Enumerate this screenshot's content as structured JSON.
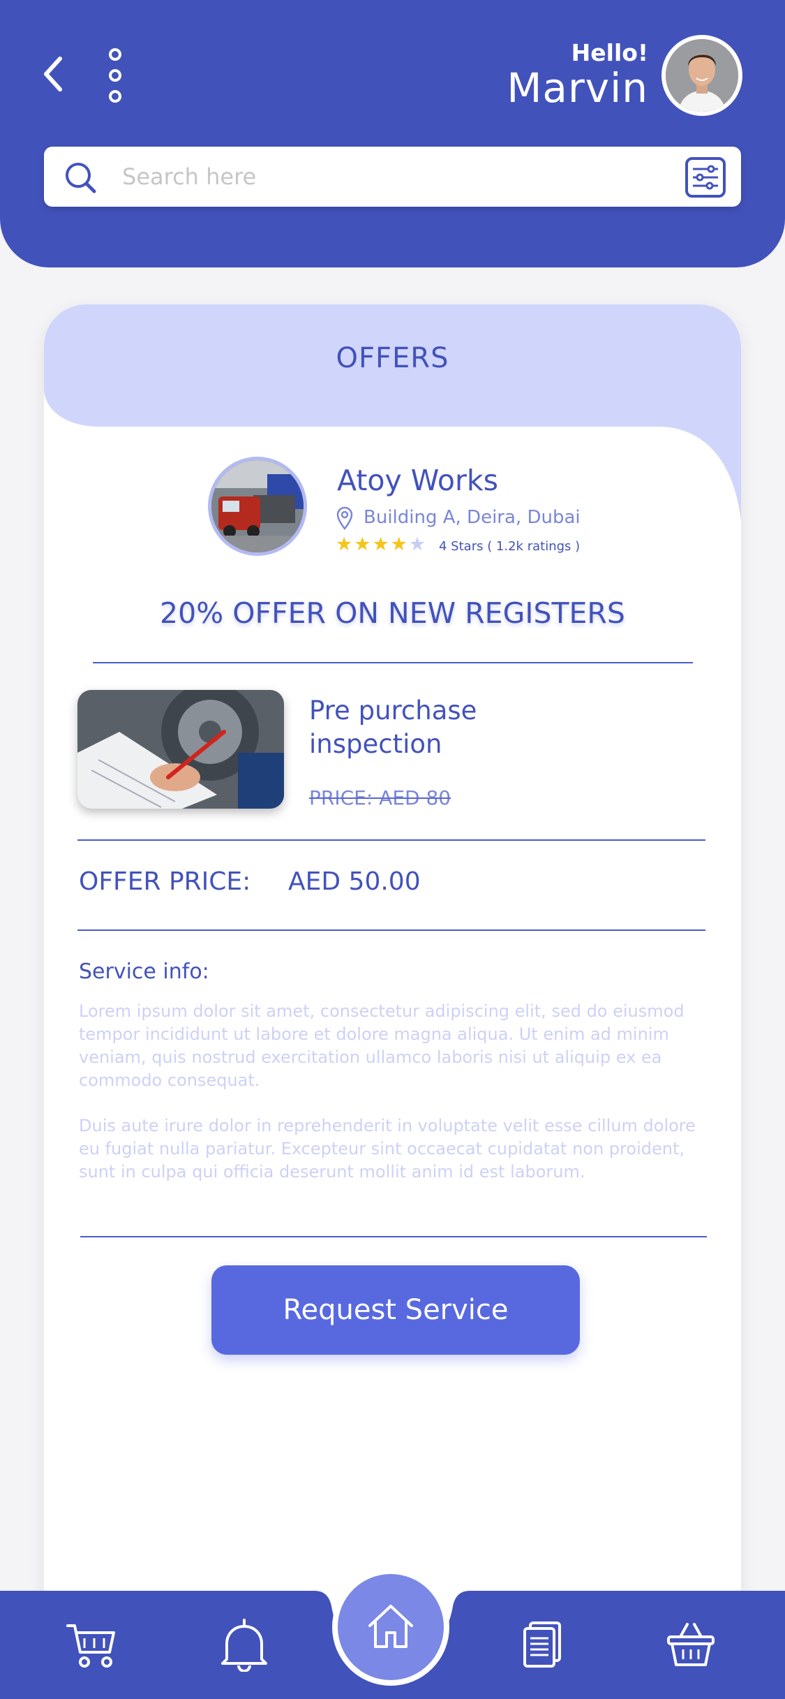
{
  "header": {
    "greeting": "Hello!",
    "user_name": "Marvin"
  },
  "search": {
    "placeholder": "Search here"
  },
  "offers": {
    "title": "OFFERS",
    "business": {
      "name": "Atoy Works",
      "location": "Building A, Deira, Dubai",
      "rating_stars": 4,
      "rating_text": "4 Stars ( 1.2k ratings )"
    },
    "headline": "20% OFFER ON NEW REGISTERS",
    "service": {
      "name": "Pre purchase inspection",
      "price": "PRICE:   AED 80"
    },
    "offer_price_label": "OFFER PRICE:",
    "offer_price_value": "AED 50.00",
    "service_info_title": "Service info:",
    "service_info_p1": "Lorem ipsum dolor sit amet, consectetur adipiscing elit, sed do eiusmod tempor incididunt ut labore et dolore magna aliqua. Ut enim ad minim veniam, quis nostrud exercitation ullamco laboris nisi ut aliquip ex ea commodo consequat.",
    "service_info_p2": "Duis aute irure dolor in reprehenderit in voluptate velit esse cillum dolore eu fugiat nulla pariatur. Excepteur sint occaecat cupidatat non proident, sunt in culpa qui officia deserunt mollit anim id est laborum.",
    "request_button": "Request Service"
  },
  "colors": {
    "primary": "#4252bb",
    "accent_light": "#d0d6fb",
    "button": "#5869e0",
    "nav_home": "#7b88e6"
  },
  "bottom_nav": {
    "icons": [
      "cart-icon",
      "bell-icon",
      "home-icon",
      "documents-icon",
      "basket-icon"
    ]
  }
}
